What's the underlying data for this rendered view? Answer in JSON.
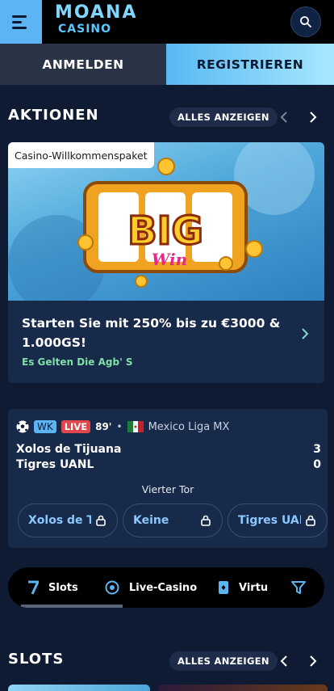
{
  "header": {
    "logo_top": "MOANA",
    "logo_bottom": "CASINO"
  },
  "auth": {
    "login_label": "ANMELDEN",
    "register_label": "REGISTRIEREN"
  },
  "promotions": {
    "title": "AKTIONEN",
    "show_all": "ALLES ANZEIGEN",
    "card": {
      "badge": "Casino-Willkommenspaket",
      "headline": "Starten Sie mit 250% bis zu €3000 & 1.000GS!",
      "terms": "Es Gelten Die Agb' S",
      "image_text_big": "BIG",
      "image_text_win": "Win"
    }
  },
  "match": {
    "competition_badge": "WK",
    "live_label": "LIVE",
    "minute": "89'",
    "separator": "•",
    "league": "Mexico Liga MX",
    "team_home": "Xolos de Tijuana",
    "score_home": "3",
    "team_away": "Tigres UANL",
    "score_away": "0",
    "market": "Vierter Tor",
    "odds": [
      {
        "label": "Xolos de Tijuana"
      },
      {
        "label": "Keine"
      },
      {
        "label": "Tigres UANL"
      }
    ]
  },
  "tabs": [
    {
      "label": "Slots",
      "icon": "seven-icon"
    },
    {
      "label": "Live-Casino",
      "icon": "casino-chip-icon"
    },
    {
      "label": "Virtu",
      "icon": "card-icon"
    }
  ],
  "slots": {
    "title": "SLOTS",
    "show_all": "ALLES ANZEIGEN"
  },
  "colors": {
    "accent_blue": "#5cb5f2",
    "background": "#0f1b33",
    "card": "#172a4a",
    "live_red": "#e0474c",
    "terms_green": "#7fe0a8"
  }
}
